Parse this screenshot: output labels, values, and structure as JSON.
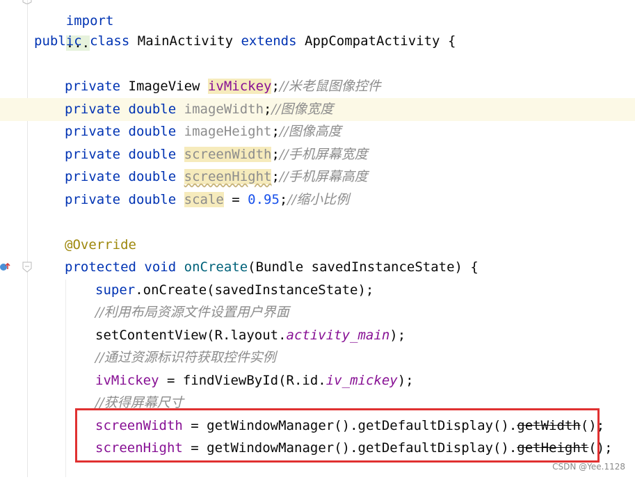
{
  "editor": {
    "lines": {
      "import": {
        "kw": "import",
        "folded": "..."
      },
      "class_decl": {
        "kw_public": "public",
        "kw_class": "class",
        "name": "MainActivity",
        "kw_extends": "extends",
        "parent": "AppCompatActivity",
        "brace": "{"
      },
      "f1": {
        "mod": "private",
        "type": "ImageView",
        "name": "ivMickey",
        "semi": ";",
        "comment": "//米老鼠图像控件"
      },
      "f2": {
        "mod": "private",
        "type": "double",
        "name": "imageWidth",
        "semi": ";",
        "comment": "//图像宽度"
      },
      "f3": {
        "mod": "private",
        "type": "double",
        "name": "imageHeight",
        "semi": ";",
        "comment": "//图像高度"
      },
      "f4": {
        "mod": "private",
        "type": "double",
        "name": "screenWidth",
        "semi": ";",
        "comment": "//手机屏幕宽度"
      },
      "f5": {
        "mod": "private",
        "type": "double",
        "name": "screenHight",
        "semi": ";",
        "comment": "//手机屏幕高度"
      },
      "f6": {
        "mod": "private",
        "type": "double",
        "name": "scale",
        "eq": " = ",
        "value": "0.95",
        "semi": ";",
        "comment": "//缩小比例"
      },
      "override": "@Override",
      "oncreate": {
        "mod": "protected",
        "type": "void",
        "name": "onCreate",
        "params": "(Bundle savedInstanceState) {"
      },
      "super_call": {
        "kw": "super",
        "rest": ".onCreate(savedInstanceState);"
      },
      "c1": "//利用布局资源文件设置用户界面",
      "set_content": {
        "call": "setContentView(R.layout.",
        "res": "activity_main",
        "end": ");"
      },
      "c2": "//通过资源标识符获取控件实例",
      "find_view": {
        "field": "ivMickey",
        "eq": " = ",
        "call": "findViewById(R.id.",
        "res": "iv_mickey",
        "end": ");"
      },
      "c3": "//获得屏幕尺寸",
      "sw": {
        "field": "screenWidth",
        "eq": " = ",
        "call": "getWindowManager().getDefaultDisplay().",
        "deprecated": "getWidth",
        "end": "();"
      },
      "sh": {
        "field": "screenHight",
        "eq": " = ",
        "call": "getWindowManager().getDefaultDisplay().",
        "deprecated": "getHeight",
        "end": "();"
      }
    }
  },
  "icons": {
    "bulb": "lightbulb-icon",
    "override": "override-method-icon",
    "fold": "fold-icon"
  },
  "colors": {
    "keyword": "#0033b3",
    "field": "#871094",
    "comment": "#8c8c8c",
    "annotation": "#9e880d",
    "number": "#1750eb",
    "highlight_box": "#e03131"
  },
  "watermark": "CSDN @Yee.1128"
}
